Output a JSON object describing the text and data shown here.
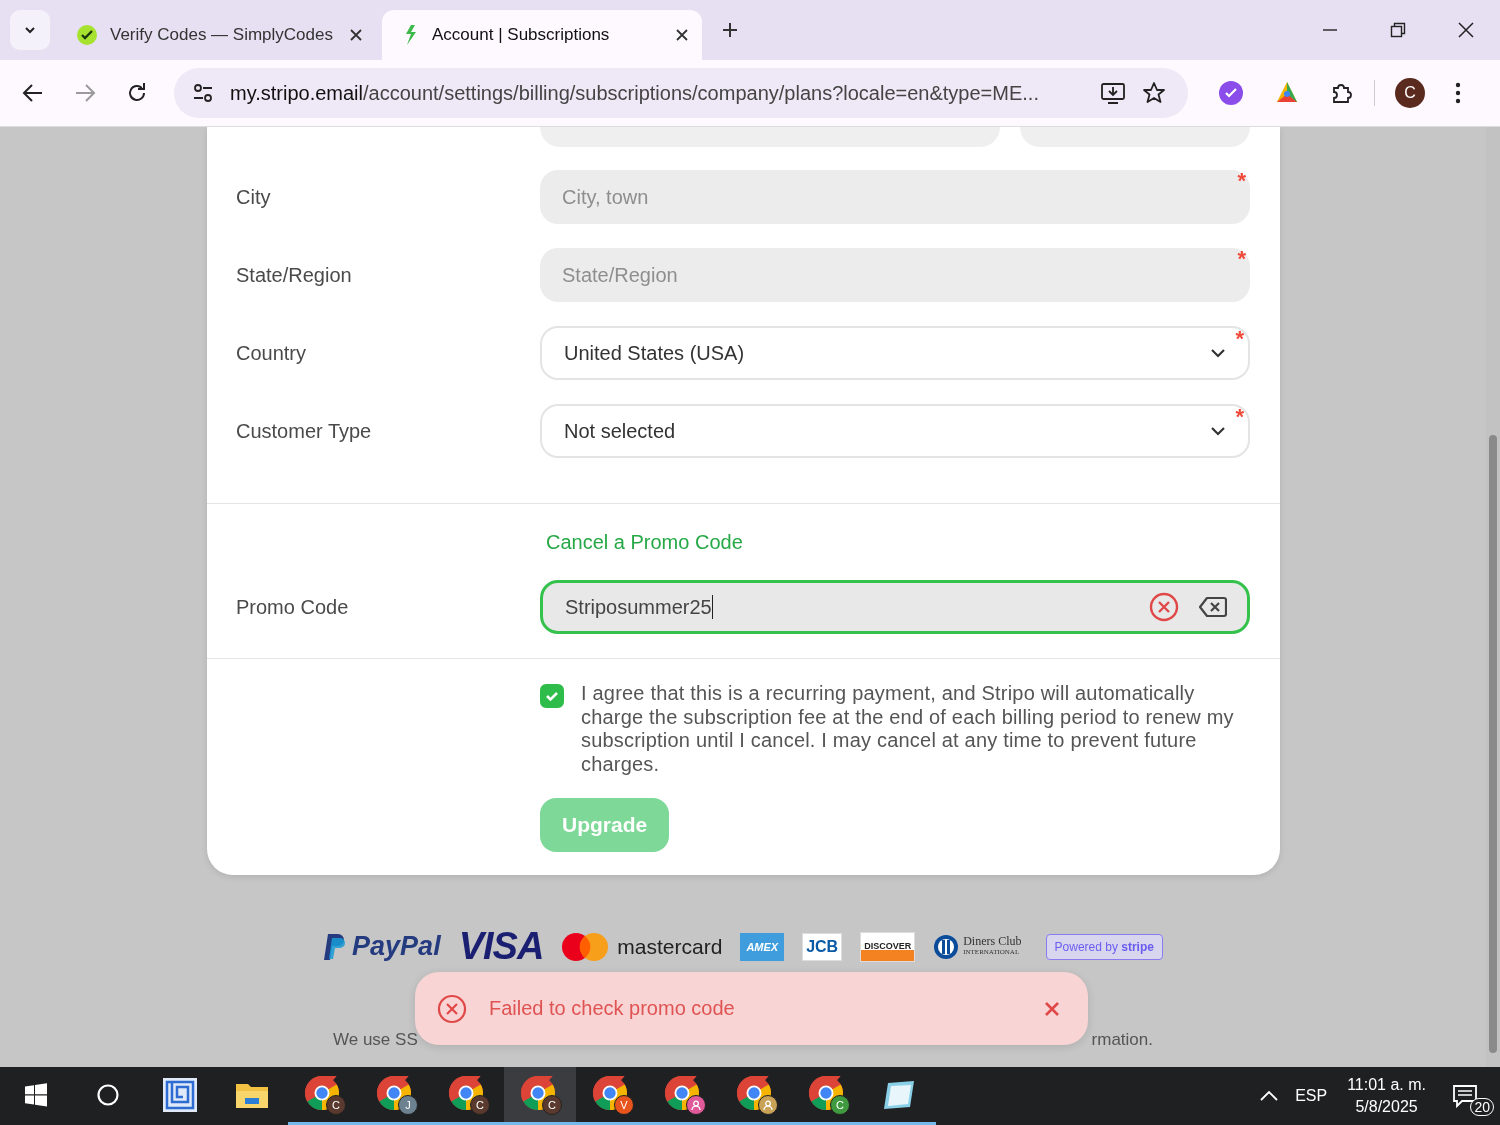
{
  "browser": {
    "tabs": [
      {
        "title": "Verify Codes — SimplyCodes",
        "kind": "simplycodes",
        "selected": false
      },
      {
        "title": "Account | Subscriptions",
        "kind": "stripo",
        "selected": true
      }
    ],
    "url_host": "my.stripo.email",
    "url_path": "/account/settings/billing/subscriptions/company/plans?locale=en&type=ME...",
    "profile_initial": "C"
  },
  "form": {
    "required_mark": "*",
    "fields": [
      {
        "label": "City",
        "kind": "text",
        "placeholder": "City, town",
        "required": true
      },
      {
        "label": "State/Region",
        "kind": "text",
        "placeholder": "State/Region",
        "required": true
      },
      {
        "label": "Country",
        "kind": "select",
        "value": "United States (USA)",
        "required": true
      },
      {
        "label": "Customer Type",
        "kind": "select",
        "value": "Not selected",
        "required": true
      }
    ],
    "promo": {
      "link": "Cancel a Promo Code",
      "label": "Promo Code",
      "value": "Striposummer25",
      "focused": true,
      "error": true
    },
    "agreement": {
      "checked": true,
      "text": "I agree that this is a recurring payment, and Stripo will automatically charge the subscription fee at the end of each billing period to renew my subscription until I cancel. I may cancel at any time to prevent future charges."
    },
    "upgrade_button": {
      "label": "Upgrade",
      "disabled": true
    }
  },
  "payment_logos": [
    {
      "kind": "paypal",
      "text": "PayPal"
    },
    {
      "kind": "visa",
      "text": "VISA"
    },
    {
      "kind": "mastercard",
      "text": "mastercard"
    },
    {
      "kind": "amex",
      "text": "AMEX"
    },
    {
      "kind": "jcb",
      "text": "JCB"
    },
    {
      "kind": "discover",
      "text": "DISCOVER"
    },
    {
      "kind": "diners",
      "text": "Diners Club",
      "subtext": "INTERNATIONAL"
    },
    {
      "kind": "stripe",
      "text": "Powered by",
      "subtext": "stripe"
    }
  ],
  "footer": {
    "text_left": "We use SS",
    "text_right": "rmation."
  },
  "toast": {
    "kind": "error",
    "message": "Failed to check promo code"
  },
  "taskbar": {
    "apps": [
      {
        "kind": "start",
        "running": false,
        "selected": false
      },
      {
        "kind": "search",
        "running": false,
        "selected": false
      },
      {
        "kind": "maze",
        "running": false,
        "selected": false
      },
      {
        "kind": "explorer",
        "running": false,
        "selected": false
      },
      {
        "kind": "chrome",
        "badge": "C",
        "color": "#5a3a2e",
        "running": true,
        "selected": false
      },
      {
        "kind": "chrome",
        "badge": "J",
        "color": "#6d8291",
        "running": true,
        "selected": false
      },
      {
        "kind": "chrome",
        "badge": "C",
        "color": "#5a3a2e",
        "running": true,
        "selected": false
      },
      {
        "kind": "chrome",
        "badge": "C",
        "color": "#5a3a2e",
        "running": true,
        "selected": true
      },
      {
        "kind": "chrome",
        "badge": "V",
        "color": "#e8541e",
        "running": true,
        "selected": false
      },
      {
        "kind": "chrome-person",
        "color": "#e05a9a",
        "running": true,
        "selected": false
      },
      {
        "kind": "chrome-person",
        "color": "#c9a257",
        "running": true,
        "selected": false
      },
      {
        "kind": "chrome",
        "badge": "C",
        "color": "#3f9a3f",
        "running": true,
        "selected": false
      },
      {
        "kind": "notes",
        "running": true,
        "selected": false
      }
    ],
    "language": "ESP",
    "time": "11:01 a. m.",
    "date": "5/8/2025",
    "notifications": "20"
  }
}
